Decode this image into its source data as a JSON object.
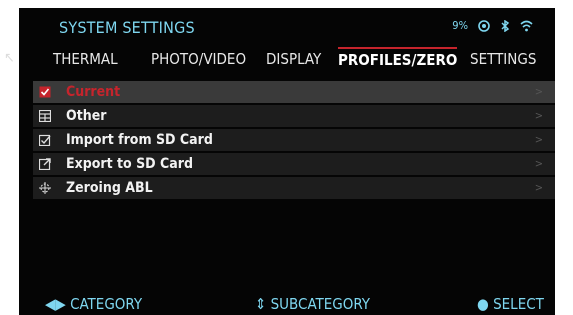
{
  "header": {
    "title": "SYSTEM SETTINGS",
    "status_text": "9%",
    "icons": [
      "battery-icon",
      "signal-icon",
      "bluetooth-icon",
      "wifi-icon"
    ]
  },
  "tabs": [
    {
      "label": "THERMAL"
    },
    {
      "label": "PHOTO/VIDEO"
    },
    {
      "label": "DISPLAY"
    },
    {
      "label": "PROFILES/ZERO",
      "active": true
    },
    {
      "label": "SETTINGS"
    }
  ],
  "list": [
    {
      "label": "Current",
      "icon": "checkbox-icon",
      "selected": true
    },
    {
      "label": "Other",
      "icon": "grid-icon"
    },
    {
      "label": "Import from SD Card",
      "icon": "import-icon"
    },
    {
      "label": "Export to SD Card",
      "icon": "export-icon"
    },
    {
      "label": "Zeroing ABL",
      "icon": "crosshair-icon"
    }
  ],
  "footer": {
    "category": "CATEGORY",
    "subcategory": "SUBCATEGORY",
    "select": "SELECT"
  },
  "colors": {
    "accent": "#7fd7f0",
    "active": "#c6242c",
    "background": "#050505"
  }
}
